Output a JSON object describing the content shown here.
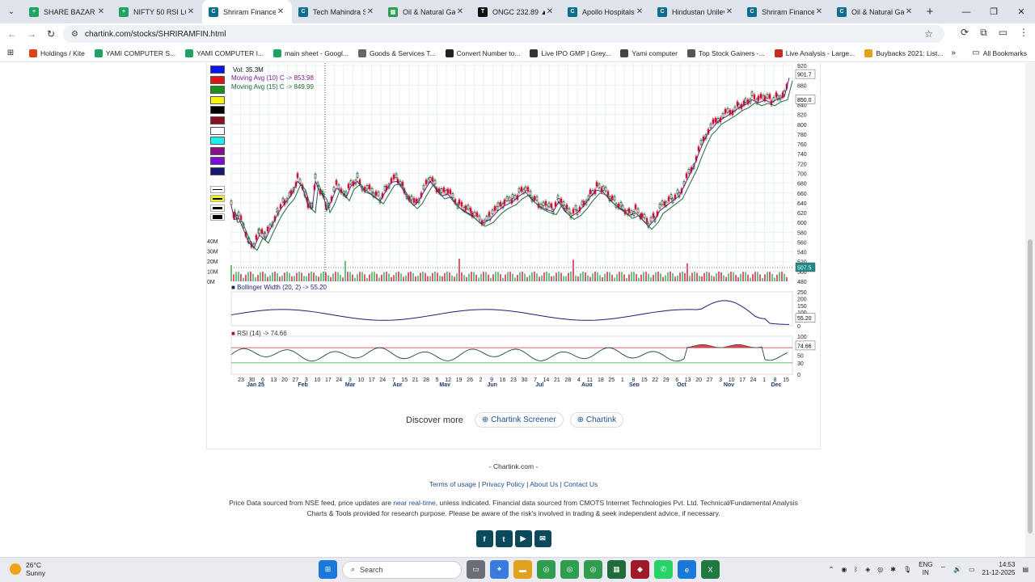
{
  "browser": {
    "tabs": [
      {
        "title": "SHARE BAZAR GO",
        "color": "#1ea362",
        "glyph": "+"
      },
      {
        "title": "NIFTY 50 RSI LOW",
        "color": "#1ea362",
        "glyph": "+"
      },
      {
        "title": "Shriram Finance S",
        "color": "#0c6e8c",
        "glyph": "C",
        "active": true
      },
      {
        "title": "Tech Mahindra Sh",
        "color": "#0c6e8c",
        "glyph": "C"
      },
      {
        "title": "Oil & Natural Gas",
        "color": "#2e9e4e",
        "glyph": "▥"
      },
      {
        "title": "ONGC 232.89 ▲",
        "color": "#111111",
        "glyph": "T"
      },
      {
        "title": "Apollo Hospitals S",
        "color": "#0c6e8c",
        "glyph": "C"
      },
      {
        "title": "Hindustan Unilev",
        "color": "#0c6e8c",
        "glyph": "C"
      },
      {
        "title": "Shriram Finance S",
        "color": "#0c6e8c",
        "glyph": "C"
      },
      {
        "title": "Oil & Natural Gas",
        "color": "#0c6e8c",
        "glyph": "C"
      }
    ],
    "new_tab": "+",
    "url": "chartink.com/stocks/SHRIRAMFIN.html",
    "bookmarks": [
      {
        "label": "Holdings / Kite",
        "color": "#e0401c"
      },
      {
        "label": "YAMI COMPUTER S...",
        "color": "#1ea362"
      },
      {
        "label": "YAMI COMPUTER I...",
        "color": "#1ea362"
      },
      {
        "label": "main sheet - Googl...",
        "color": "#1ea362"
      },
      {
        "label": "Goods & Services T...",
        "color": "#666666"
      },
      {
        "label": "Convert Number to...",
        "color": "#222222"
      },
      {
        "label": "Live IPO GMP | Grey...",
        "color": "#333333"
      },
      {
        "label": "Yami computer",
        "color": "#444444"
      },
      {
        "label": "Top Stock Gainers -...",
        "color": "#555555"
      },
      {
        "label": "Live Analysis - Large...",
        "color": "#c0301c"
      },
      {
        "label": "Buybacks 2021: List...",
        "color": "#e0a21c"
      }
    ],
    "all_bookmarks": "All Bookmarks"
  },
  "chart": {
    "legend_vol": "Vol: 35.3M",
    "legend_ma10": "Moving Avg (10) C -> 853.98",
    "legend_ma15": "Moving Avg (15) C -> 849.99",
    "bb_label": "Bollinger Width (20, 2) -> 55.20",
    "rsi_label": "RSI (14) -> 74.66",
    "price_ticks": [
      "920",
      "880",
      "840",
      "820",
      "800",
      "780",
      "760",
      "740",
      "720",
      "700",
      "680",
      "660",
      "640",
      "620",
      "600",
      "580",
      "560",
      "540",
      "520",
      "500",
      "480"
    ],
    "price_flag_high": "901.7",
    "price_flag_close": "850.0",
    "vol_flag": "507.5",
    "vol_ticks": [
      "40M",
      "30M",
      "20M",
      "10M",
      "0M"
    ],
    "bb_ticks": [
      "250",
      "200",
      "150",
      "100",
      "50",
      "0"
    ],
    "bb_flag": "55.20",
    "rsi_ticks": [
      "100",
      "70",
      "50",
      "30",
      "0"
    ],
    "rsi_flag": "74.66",
    "day_ticks": [
      "23",
      "30",
      "6",
      "13",
      "20",
      "27",
      "3",
      "10",
      "17",
      "24",
      "3",
      "10",
      "17",
      "24",
      "7",
      "15",
      "21",
      "28",
      "5",
      "12",
      "19",
      "26",
      "2",
      "9",
      "16",
      "23",
      "30",
      "7",
      "14",
      "21",
      "28",
      "4",
      "11",
      "18",
      "25",
      "1",
      "8",
      "15",
      "22",
      "29",
      "6",
      "13",
      "20",
      "27",
      "3",
      "10",
      "17",
      "24",
      "1",
      "8",
      "15"
    ],
    "month_ticks": [
      "Jan 25",
      "Feb",
      "Mar",
      "Apr",
      "May",
      "Jun",
      "Jul",
      "Aug",
      "Sep",
      "Oct",
      "Nov",
      "Dec"
    ],
    "colors": {
      "up": "#2ea84a",
      "down": "#cf1237",
      "ma10": "#6d1a7a",
      "ma15": "#1f6b3a",
      "bb": "#1a1f6e",
      "rsi": "#1a4a3a",
      "rsi_fill": "#cf2a3a"
    }
  },
  "discover": {
    "label": "Discover more",
    "btn1": "Chartink Screener",
    "btn2": "Chartink"
  },
  "footer": {
    "site": "- Chartink.com -",
    "terms": "Terms of usage",
    "privacy": "Privacy Policy",
    "about": "About Us",
    "contact": "Contact Us",
    "note_a": "Price Data sourced from NSE feed, price updates are",
    "note_rt": "near real-time",
    "note_b": ", unless indicated. Financial data sourced from CMOTS Internet Technologies Pvt. Ltd. Technical/Fundamental Analysis",
    "note_c": "Charts & Tools provided for research purpose. Please be aware of the risk's involved in trading & seek independent advice, if necessary."
  },
  "taskbar": {
    "temp": "26°C",
    "weather": "Sunny",
    "search": "Search",
    "lang1": "ENG",
    "lang2": "IN",
    "time": "14:53",
    "date": "21-12-2025"
  }
}
